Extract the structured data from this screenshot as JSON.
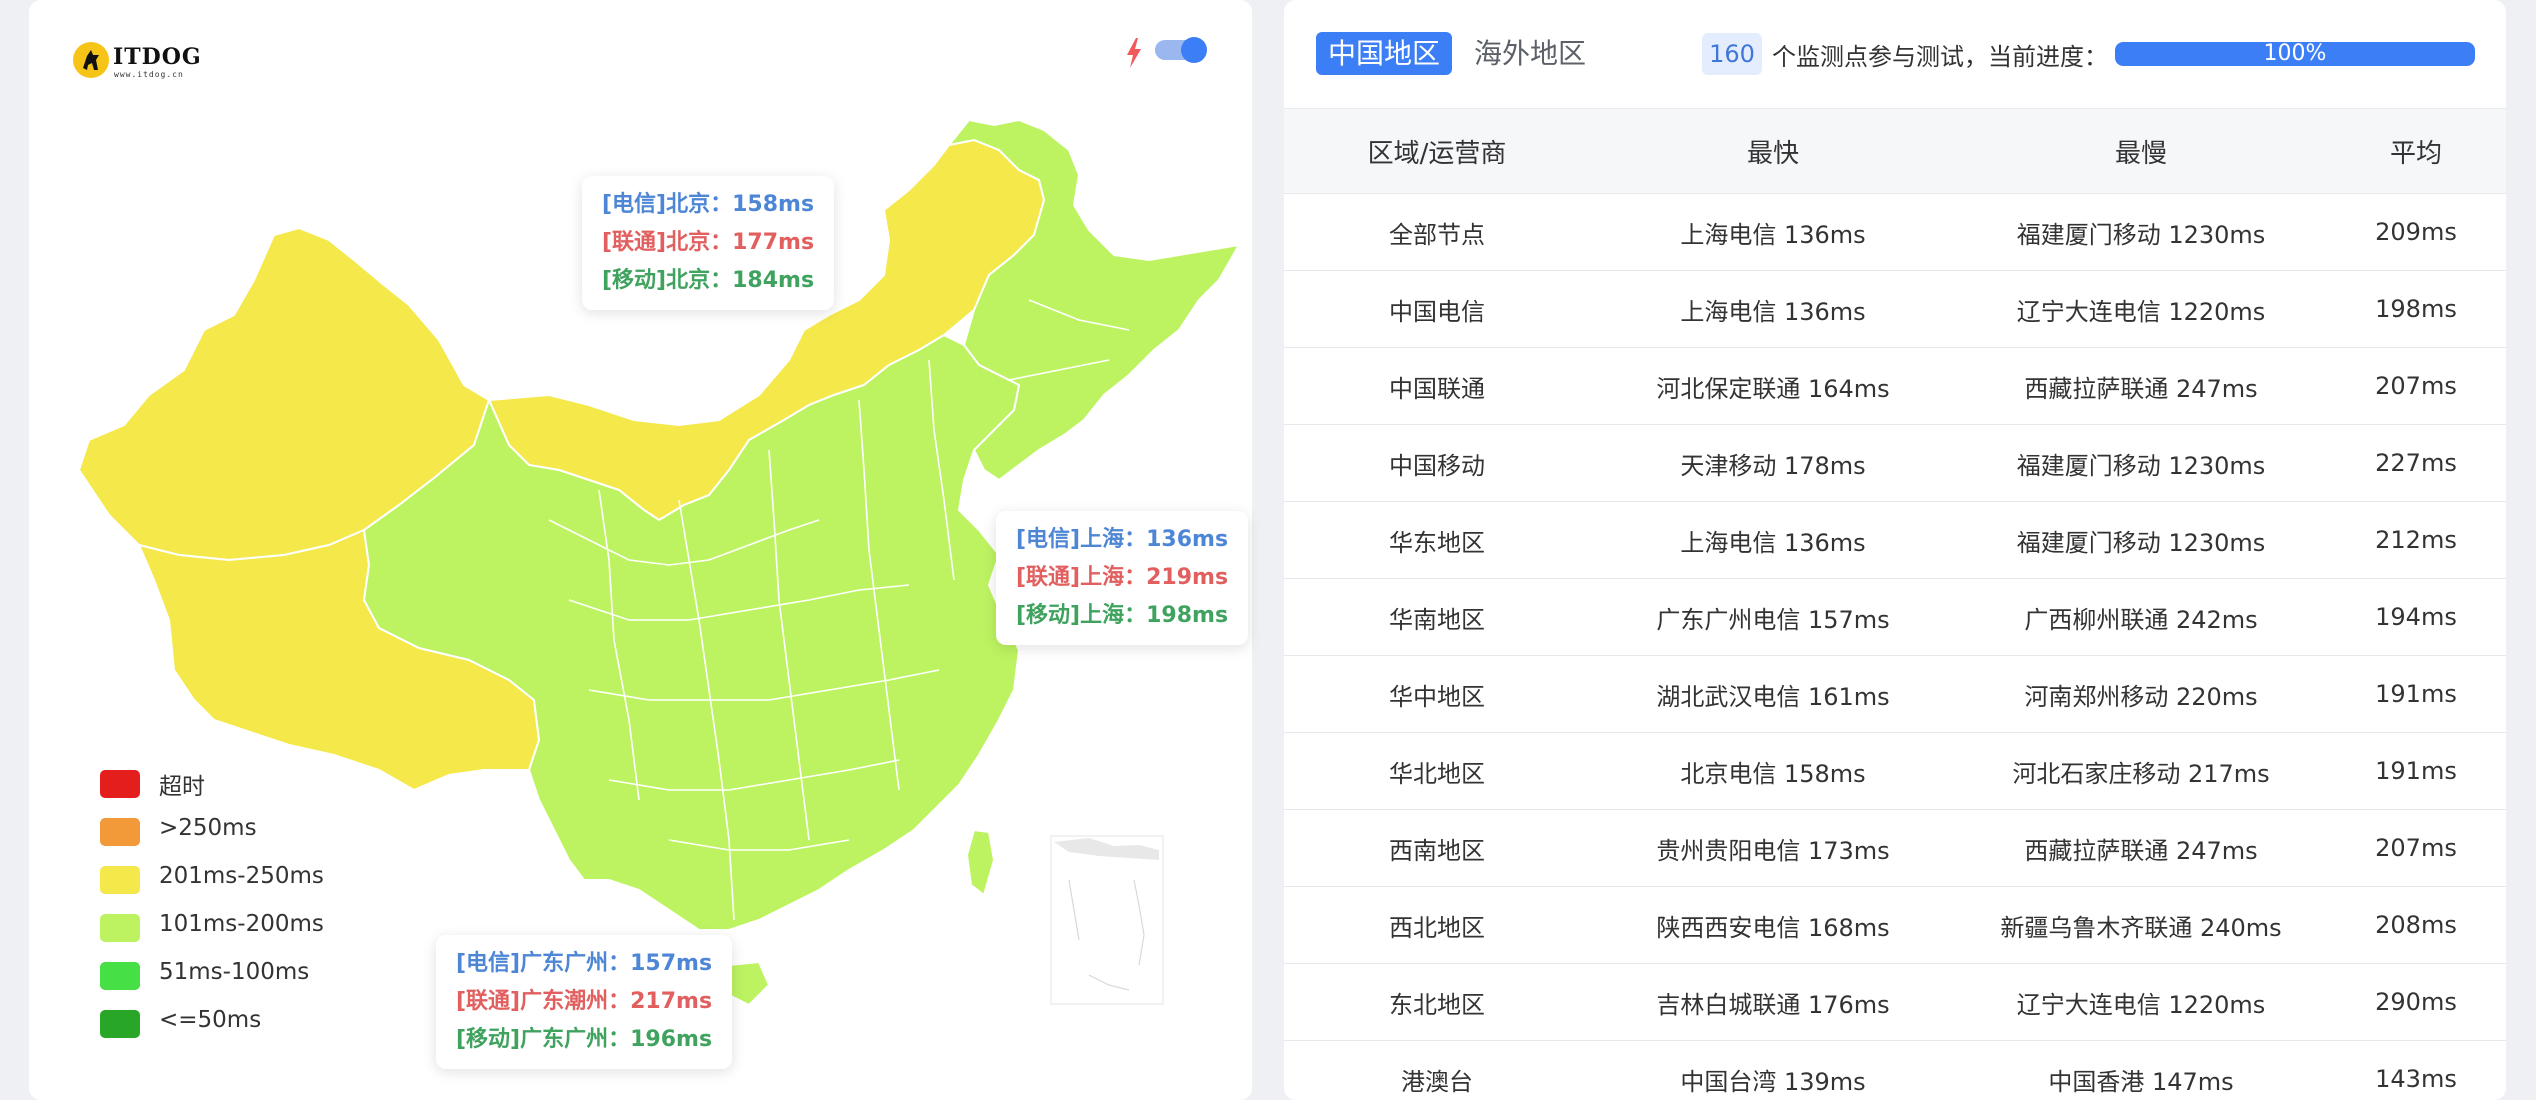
{
  "logo": {
    "name": "ITDOG",
    "url": "www.itdog.cn"
  },
  "colors": {
    "accent": "#3c7ef6",
    "map_yellow": "#f5e84b",
    "map_green": "#bdf361",
    "beijing_dx": "#4e86d6",
    "lt": "#e25f5f",
    "yd": "#3fa35f"
  },
  "toggle": {
    "on": true
  },
  "tooltips": {
    "beijing": {
      "dx": "[电信]北京：158ms",
      "lt": "[联通]北京：177ms",
      "yd": "[移动]北京：184ms"
    },
    "shanghai": {
      "dx": "[电信]上海：136ms",
      "lt": "[联通]上海：219ms",
      "yd": "[移动]上海：198ms"
    },
    "guangzhou": {
      "dx": "[电信]广东广州：157ms",
      "lt": "[联通]广东潮州：217ms",
      "yd": "[移动]广东广州：196ms"
    }
  },
  "legend": [
    {
      "label": "超时",
      "color": "#e41d1d"
    },
    {
      "label": ">250ms",
      "color": "#f29a3a"
    },
    {
      "label": "201ms-250ms",
      "color": "#f5e84b"
    },
    {
      "label": "101ms-200ms",
      "color": "#bdf361"
    },
    {
      "label": "51ms-100ms",
      "color": "#46e046"
    },
    {
      "label": "<=50ms",
      "color": "#27a627"
    }
  ],
  "tabs": {
    "active": "中国地区",
    "inactive": "海外地区"
  },
  "monitor": {
    "count": "160",
    "text": "个监测点参与测试，当前进度：",
    "progress_label": "100%",
    "progress": 1.0
  },
  "table": {
    "headers": [
      "区域/运营商",
      "最快",
      "最慢",
      "平均"
    ],
    "rows": [
      [
        "全部节点",
        "上海电信 136ms",
        "福建厦门移动 1230ms",
        "209ms"
      ],
      [
        "中国电信",
        "上海电信 136ms",
        "辽宁大连电信 1220ms",
        "198ms"
      ],
      [
        "中国联通",
        "河北保定联通 164ms",
        "西藏拉萨联通 247ms",
        "207ms"
      ],
      [
        "中国移动",
        "天津移动 178ms",
        "福建厦门移动 1230ms",
        "227ms"
      ],
      [
        "华东地区",
        "上海电信 136ms",
        "福建厦门移动 1230ms",
        "212ms"
      ],
      [
        "华南地区",
        "广东广州电信 157ms",
        "广西柳州联通 242ms",
        "194ms"
      ],
      [
        "华中地区",
        "湖北武汉电信 161ms",
        "河南郑州移动 220ms",
        "191ms"
      ],
      [
        "华北地区",
        "北京电信 158ms",
        "河北石家庄移动 217ms",
        "191ms"
      ],
      [
        "西南地区",
        "贵州贵阳电信 173ms",
        "西藏拉萨联通 247ms",
        "207ms"
      ],
      [
        "西北地区",
        "陕西西安电信 168ms",
        "新疆乌鲁木齐联通 240ms",
        "208ms"
      ],
      [
        "东北地区",
        "吉林白城联通 176ms",
        "辽宁大连电信 1220ms",
        "290ms"
      ],
      [
        "港澳台",
        "中国台湾 139ms",
        "中国香港 147ms",
        "143ms"
      ]
    ]
  }
}
